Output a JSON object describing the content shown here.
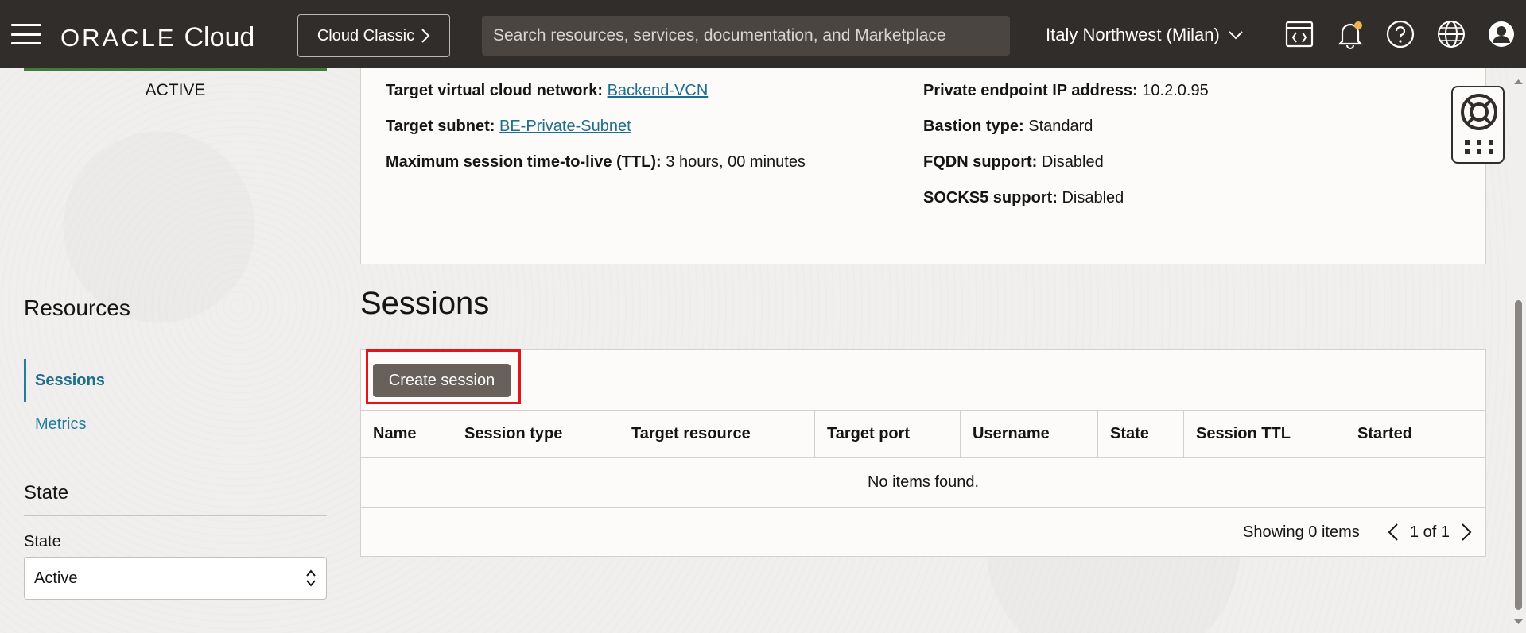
{
  "header": {
    "logo_oracle": "ORACLE",
    "logo_cloud": "Cloud",
    "classic_button": "Cloud Classic",
    "search_placeholder": "Search resources, services, documentation, and Marketplace",
    "region": "Italy Northwest (Milan)"
  },
  "sidebar": {
    "status": "ACTIVE",
    "resources_title": "Resources",
    "nav": [
      {
        "label": "Sessions"
      },
      {
        "label": "Metrics"
      }
    ],
    "state_title": "State",
    "state_label": "State",
    "state_value": "Active"
  },
  "details": {
    "vcn_label": "Target virtual cloud network:",
    "vcn_value": "Backend-VCN",
    "subnet_label": "Target subnet:",
    "subnet_value": "BE-Private-Subnet",
    "ttl_label": "Maximum session time-to-live (TTL):",
    "ttl_value": "3 hours, 00 minutes",
    "ip_label": "Private endpoint IP address:",
    "ip_value": "10.2.0.95",
    "bastion_type_label": "Bastion type:",
    "bastion_type_value": "Standard",
    "fqdn_label": "FQDN support:",
    "fqdn_value": "Disabled",
    "socks_label": "SOCKS5 support:",
    "socks_value": "Disabled"
  },
  "sessions": {
    "title": "Sessions",
    "create_button": "Create session",
    "columns": [
      "Name",
      "Session type",
      "Target resource",
      "Target port",
      "Username",
      "State",
      "Session TTL",
      "Started"
    ],
    "empty_message": "No items found.",
    "showing": "Showing 0 items",
    "page": "1 of 1"
  }
}
